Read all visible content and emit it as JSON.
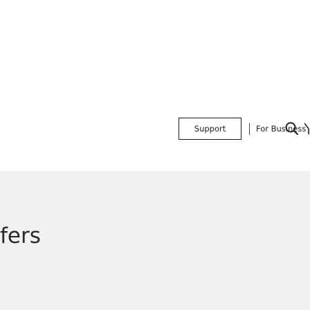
{
  "header": {
    "nav": {
      "support_label": "Support",
      "business_label": "For Business"
    },
    "icons": {
      "search": "search-icon",
      "cut_off": "partial-icon"
    }
  },
  "hero": {
    "heading_fragment": "fers"
  },
  "colors": {
    "header_bg": "#ffffff",
    "hero_bg": "#f1f1f1",
    "text": "#222222",
    "border": "#1a1a1a"
  }
}
